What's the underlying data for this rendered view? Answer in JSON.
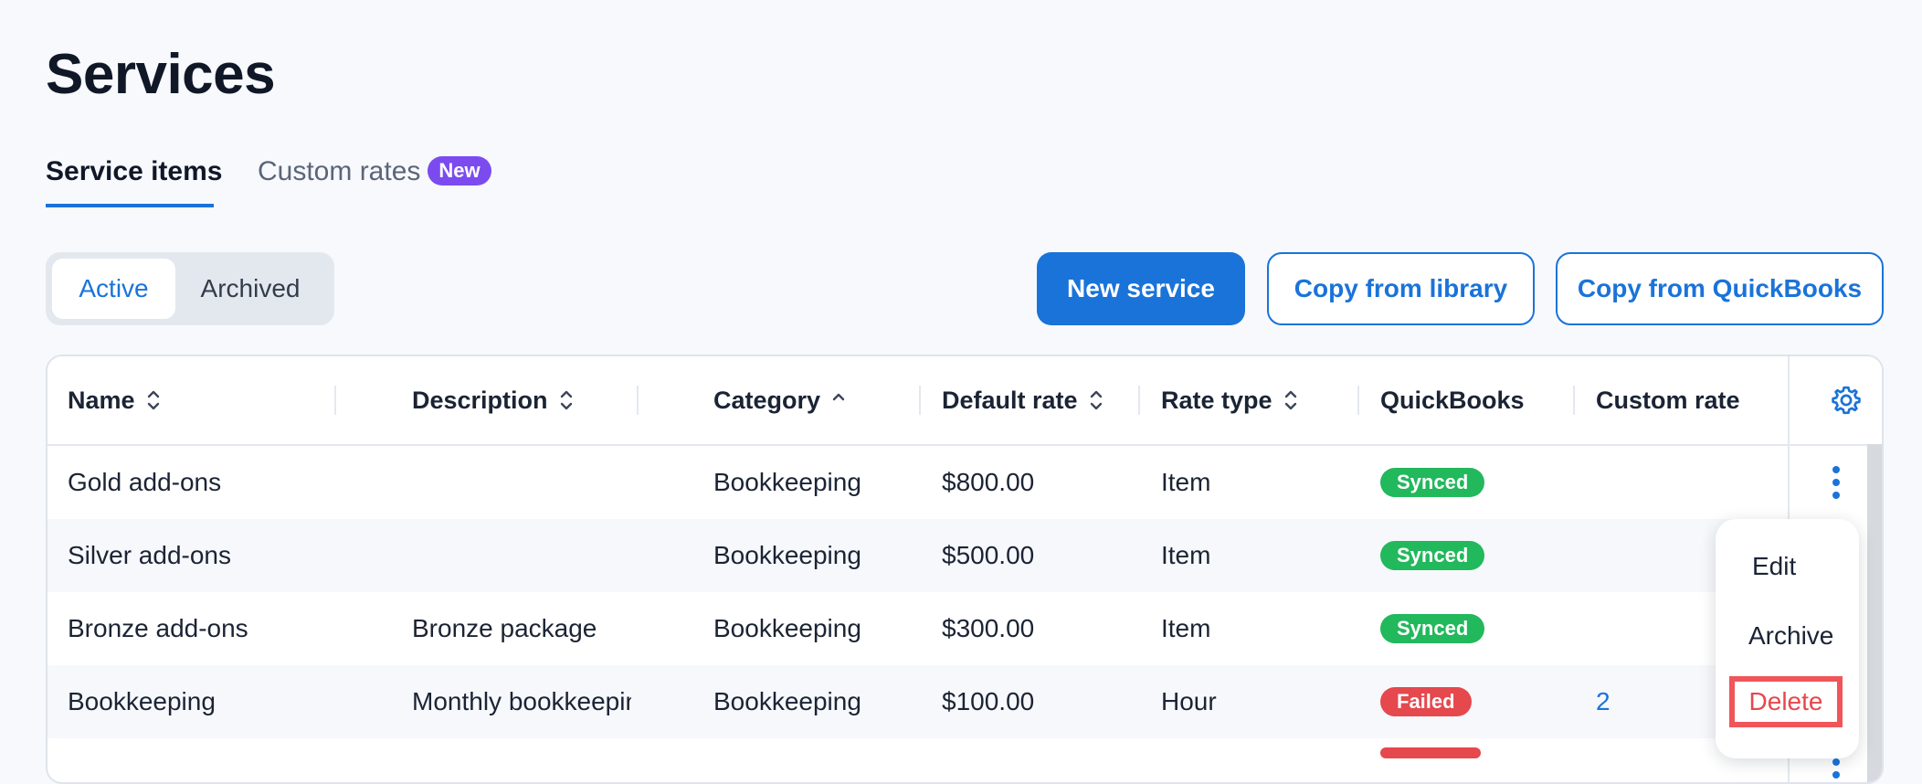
{
  "page": {
    "title": "Services"
  },
  "tabs": [
    {
      "label": "Service items",
      "selected": true
    },
    {
      "label": "Custom rates",
      "badge": "New",
      "selected": false
    }
  ],
  "filter": {
    "options": [
      "Active",
      "Archived"
    ],
    "selected": "Active"
  },
  "actions": {
    "new_service": "New service",
    "copy_library": "Copy from library",
    "copy_quickbooks": "Copy from QuickBooks"
  },
  "table": {
    "columns": [
      {
        "label": "Name",
        "sort": "both"
      },
      {
        "label": "Description",
        "sort": "both"
      },
      {
        "label": "Category",
        "sort": "asc"
      },
      {
        "label": "Default rate",
        "sort": "both"
      },
      {
        "label": "Rate type",
        "sort": "both"
      },
      {
        "label": "QuickBooks",
        "sort": "none"
      },
      {
        "label": "Custom rate",
        "sort": "none"
      }
    ],
    "rows": [
      {
        "name": "Gold add-ons",
        "description": "",
        "category": "Bookkeeping",
        "default_rate": "$800.00",
        "rate_type": "Item",
        "quickbooks": "Synced",
        "custom_rate": ""
      },
      {
        "name": "Silver add-ons",
        "description": "",
        "category": "Bookkeeping",
        "default_rate": "$500.00",
        "rate_type": "Item",
        "quickbooks": "Synced",
        "custom_rate": ""
      },
      {
        "name": "Bronze add-ons",
        "description": "Bronze package",
        "category": "Bookkeeping",
        "default_rate": "$300.00",
        "rate_type": "Item",
        "quickbooks": "Synced",
        "custom_rate": ""
      },
      {
        "name": "Bookkeeping",
        "description": "Monthly bookkeeping…",
        "category": "Bookkeeping",
        "default_rate": "$100.00",
        "rate_type": "Hour",
        "quickbooks": "Failed",
        "custom_rate": "2"
      }
    ]
  },
  "row_menu": {
    "items": [
      "Edit",
      "Archive",
      "Delete"
    ]
  },
  "colors": {
    "primary": "#1a73d9",
    "synced": "#22b85c",
    "failed": "#e5484d",
    "new_badge": "#7b4bf0",
    "danger_highlight": "#f0555a"
  },
  "icons": {
    "sort": "sort-updown-icon",
    "sort_asc": "chevron-up-icon",
    "settings": "gear-icon",
    "row_actions": "kebab-vertical-icon"
  }
}
